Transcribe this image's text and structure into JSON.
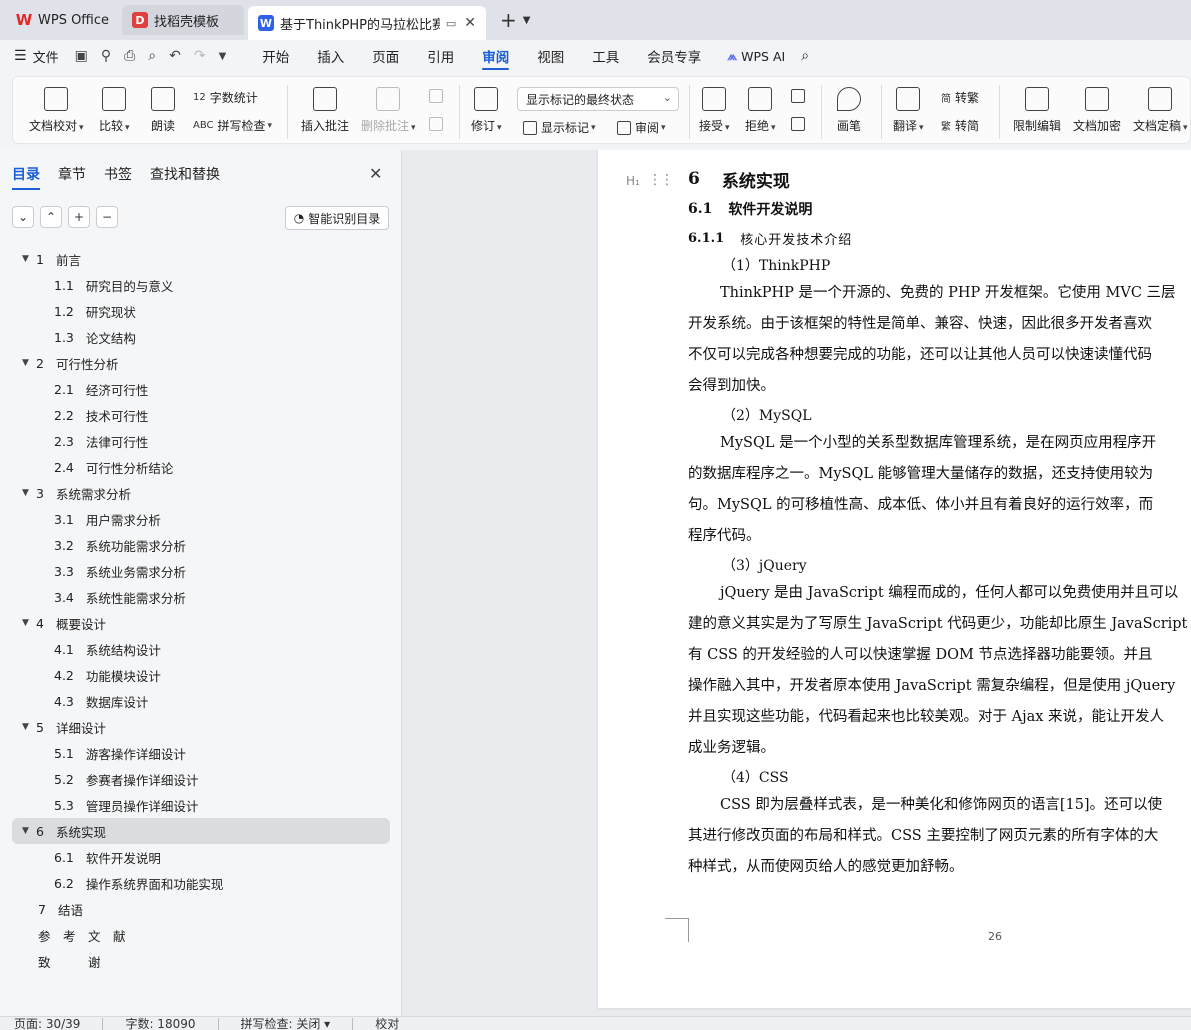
{
  "tabs": [
    {
      "label": "WPS Office",
      "icon": "wps-logo-icon"
    },
    {
      "label": "找稻壳模板",
      "icon": "docer-icon"
    },
    {
      "label": "基于ThinkPHP的马拉松比赛报",
      "icon": "word-doc-icon"
    }
  ],
  "menubar": {
    "file_label": "文件",
    "items": [
      "开始",
      "插入",
      "页面",
      "引用",
      "审阅",
      "视图",
      "工具",
      "会员专享"
    ],
    "active": "审阅",
    "ai_label": "WPS AI"
  },
  "ribbon": {
    "doc_check": "文档校对",
    "compare": "比较",
    "read_aloud": "朗读",
    "word_count": "字数统计",
    "spell_check": "拼写检查",
    "insert_comment": "插入批注",
    "delete_comment": "删除批注",
    "track_changes": "修订",
    "markup_state": "显示标记的最终状态",
    "show_markup": "显示标记",
    "review": "审阅",
    "accept": "接受",
    "reject": "拒绝",
    "ink": "画笔",
    "translate": "翻译",
    "to_traditional": "转繁",
    "to_simplified": "转简",
    "restrict_edit": "限制编辑",
    "encrypt": "文档加密",
    "finalize": "文档定稿"
  },
  "nav": {
    "tabs": [
      "目录",
      "章节",
      "书签",
      "查找和替换"
    ],
    "active_tab": "目录",
    "smart_toc": "智能识别目录",
    "toc": [
      {
        "num": "1",
        "text": "前言",
        "level": 1
      },
      {
        "num": "1.1",
        "text": "研究目的与意义",
        "level": 2
      },
      {
        "num": "1.2",
        "text": "研究现状",
        "level": 2
      },
      {
        "num": "1.3",
        "text": "论文结构",
        "level": 2
      },
      {
        "num": "2",
        "text": "可行性分析",
        "level": 1
      },
      {
        "num": "2.1",
        "text": "经济可行性",
        "level": 2
      },
      {
        "num": "2.2",
        "text": "技术可行性",
        "level": 2
      },
      {
        "num": "2.3",
        "text": "法律可行性",
        "level": 2
      },
      {
        "num": "2.4",
        "text": "可行性分析结论",
        "level": 2
      },
      {
        "num": "3",
        "text": "系统需求分析",
        "level": 1
      },
      {
        "num": "3.1",
        "text": "用户需求分析",
        "level": 2
      },
      {
        "num": "3.2",
        "text": "系统功能需求分析",
        "level": 2
      },
      {
        "num": "3.3",
        "text": "系统业务需求分析",
        "level": 2
      },
      {
        "num": "3.4",
        "text": "系统性能需求分析",
        "level": 2
      },
      {
        "num": "4",
        "text": "概要设计",
        "level": 1
      },
      {
        "num": "4.1",
        "text": "系统结构设计",
        "level": 2
      },
      {
        "num": "4.2",
        "text": "功能模块设计",
        "level": 2
      },
      {
        "num": "4.3",
        "text": "数据库设计",
        "level": 2
      },
      {
        "num": "5",
        "text": "详细设计",
        "level": 1
      },
      {
        "num": "5.1",
        "text": "游客操作详细设计",
        "level": 2
      },
      {
        "num": "5.2",
        "text": "参赛者操作详细设计",
        "level": 2
      },
      {
        "num": "5.3",
        "text": "管理员操作详细设计",
        "level": 2
      },
      {
        "num": "6",
        "text": "系统实现",
        "level": 1,
        "selected": true
      },
      {
        "num": "6.1",
        "text": "软件开发说明",
        "level": 2
      },
      {
        "num": "6.2",
        "text": "操作系统界面和功能实现",
        "level": 2
      },
      {
        "num": "7",
        "text": "结语",
        "level": 0
      },
      {
        "num": "",
        "text": "参　考　文　献",
        "level": 0
      },
      {
        "num": "",
        "text": "致　　　谢",
        "level": 0
      }
    ]
  },
  "doc": {
    "h1_num": "6",
    "h1_text": "系统实现",
    "h2_num": "6.1",
    "h2_text": "软件开发说明",
    "h3_num": "6.1.1",
    "h3_text": "核心开发技术介绍",
    "sec1_title": "（1）ThinkPHP",
    "sec1_lines": [
      "ThinkPHP 是一个开源的、免费的 PHP 开发框架。它使用 MVC 三层",
      "开发系统。由于该框架的特性是简单、兼容、快速，因此很多开发者喜欢",
      "不仅可以完成各种想要完成的功能，还可以让其他人员可以快速读懂代码",
      "会得到加快。"
    ],
    "sec2_title": "（2）MySQL",
    "sec2_lines": [
      "MySQL 是一个小型的关系型数据库管理系统，是在网页应用程序开",
      "的数据库程序之一。MySQL 能够管理大量储存的数据，还支持使用较为",
      "句。MySQL 的可移植性高、成本低、体小并且有着良好的运行效率，而",
      "程序代码。"
    ],
    "sec3_title": "（3）jQuery",
    "sec3_lines": [
      "jQuery 是由 JavaScript 编程而成的，任何人都可以免费使用并且可以",
      "建的意义其实是为了写原生 JavaScript 代码更少，功能却比原生 JavaScript",
      "有 CSS 的开发经验的人可以快速掌握 DOM 节点选择器功能要领。并且",
      "操作融入其中，开发者原本使用 JavaScript 需复杂编程，但是使用 jQuery",
      "并且实现这些功能，代码看起来也比较美观。对于 Ajax 来说，能让开发人",
      "成业务逻辑。"
    ],
    "sec4_title": "（4）CSS",
    "sec4_lines": [
      "CSS 即为层叠样式表，是一种美化和修饰网页的语言[15]。还可以使",
      "其进行修改页面的布局和样式。CSS 主要控制了网页元素的所有字体的大",
      "种样式，从而使网页给人的感觉更加舒畅。"
    ],
    "page_number": "26"
  },
  "status": {
    "page": "页面: 30/39",
    "words": "字数: 18090",
    "spell": "拼写检查: 关闭",
    "proof": "校对"
  },
  "colors": {
    "accent": "#1c5ed6",
    "wps_red": "#e02929",
    "doc_blue": "#2f62e9"
  }
}
